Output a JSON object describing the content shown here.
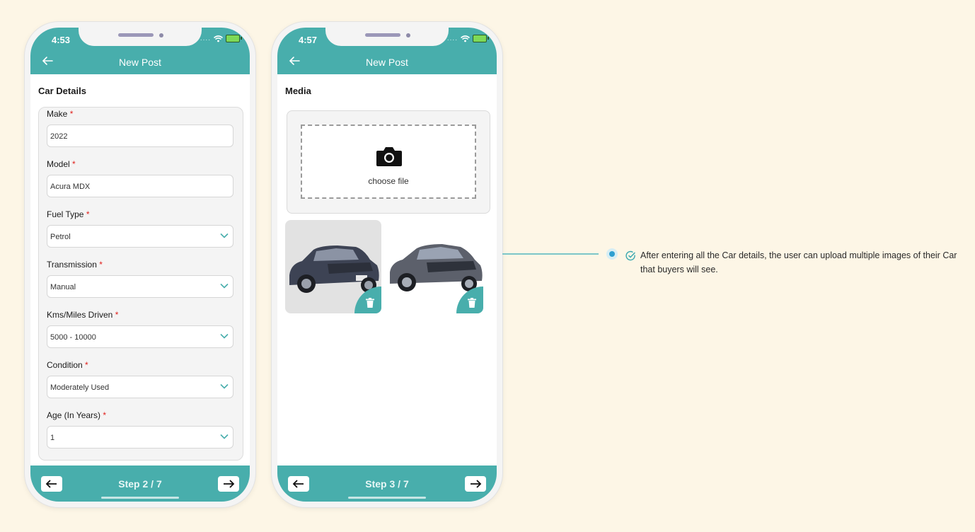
{
  "screens": [
    {
      "time": "4:53",
      "header_title": "New Post",
      "section_title": "Car Details",
      "fields": [
        {
          "label": "Make",
          "required": "*",
          "value": "2022",
          "type": "text"
        },
        {
          "label": "Model",
          "required": "*",
          "value": "Acura MDX",
          "type": "text"
        },
        {
          "label": "Fuel Type",
          "required": "*",
          "value": "Petrol",
          "type": "select"
        },
        {
          "label": "Transmission",
          "required": "*",
          "value": "Manual",
          "type": "select"
        },
        {
          "label": "Kms/Miles Driven",
          "required": "*",
          "value": "5000 - 10000",
          "type": "select"
        },
        {
          "label": "Condition",
          "required": "*",
          "value": "Moderately Used",
          "type": "select"
        },
        {
          "label": "Age (In Years)",
          "required": "*",
          "value": "1",
          "type": "select"
        }
      ],
      "step": "Step 2 / 7"
    },
    {
      "time": "4:57",
      "header_title": "New Post",
      "section_title": "Media",
      "upload_label": "choose file",
      "images": [
        "car-photo-1",
        "car-photo-2"
      ],
      "step": "Step 3 / 7"
    }
  ],
  "annotation": {
    "text": "After entering all the Car details, the user can upload multiple images of their Car that buyers will see."
  },
  "colors": {
    "accent": "#48aeac",
    "background": "#fdf6e6",
    "required": "#e0201c",
    "marker": "#2e9fd0"
  }
}
